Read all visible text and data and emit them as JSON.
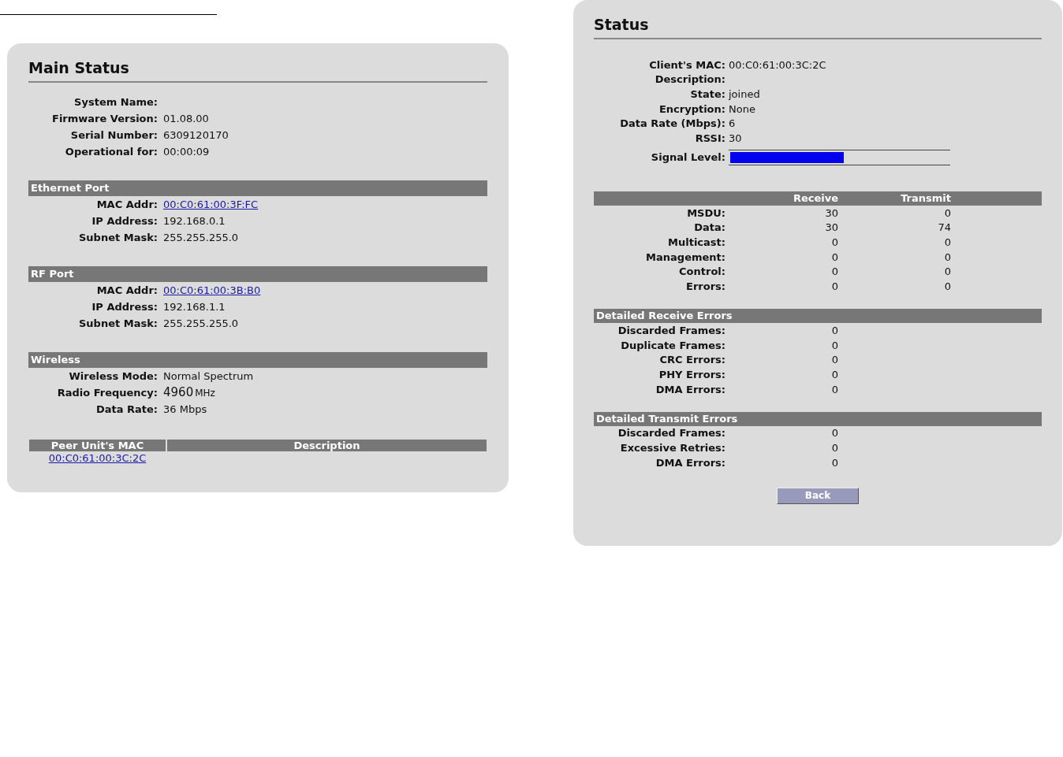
{
  "main_status": {
    "title": "Main Status",
    "info": [
      {
        "label": "System Name:"
      },
      {
        "label": "Firmware Version:",
        "value": "01.08.00"
      },
      {
        "label": "Serial Number:",
        "value": "6309120170"
      },
      {
        "label": "Operational for:",
        "value": "00:00:09"
      }
    ],
    "sections": [
      {
        "title": "Ethernet Port",
        "rows": [
          {
            "kind": "link",
            "label": "MAC Addr:",
            "value": "00:C0:61:00:3F:FC"
          },
          {
            "kind": "text",
            "label": "IP Address:",
            "value": "192.168.0.1"
          },
          {
            "kind": "text",
            "label": "Subnet Mask:",
            "value": "255.255.255.0"
          }
        ]
      },
      {
        "title": "RF Port",
        "rows": [
          {
            "kind": "link",
            "label": "MAC Addr:",
            "value": "00:C0:61:00:3B:B0"
          },
          {
            "kind": "text",
            "label": "IP Address:",
            "value": "192.168.1.1"
          },
          {
            "kind": "text",
            "label": "Subnet Mask:",
            "value": "255.255.255.0"
          }
        ]
      },
      {
        "title": "Wireless",
        "rows": [
          {
            "kind": "text",
            "label": "Wireless Mode:",
            "value": "Normal Spectrum"
          },
          {
            "kind": "frequency",
            "label": "Radio Frequency:",
            "value": "4960",
            "unit": "MHz"
          },
          {
            "kind": "text",
            "label": "Data Rate:",
            "value": "36 Mbps"
          }
        ]
      }
    ],
    "peers": {
      "columns": [
        "Peer Unit's MAC",
        "Description"
      ],
      "rows": [
        {
          "mac": "00:C0:61:00:3C:2C"
        }
      ]
    }
  },
  "status": {
    "title": "Status",
    "info": [
      {
        "label": "Client's MAC:",
        "value": "00:C0:61:00:3C:2C"
      },
      {
        "label": "Description:"
      },
      {
        "label": "State:",
        "value": "joined"
      },
      {
        "label": "Encryption:",
        "value": "None"
      },
      {
        "label": "Data Rate (Mbps):",
        "value": "6"
      },
      {
        "label": "RSSI:",
        "value": "30"
      }
    ],
    "signal": {
      "label": "Signal Level:",
      "level": 0.52
    },
    "counters": {
      "columns": [
        "Receive",
        "Transmit"
      ],
      "rows": [
        {
          "label": "MSDU:",
          "receive": "30",
          "transmit": "0"
        },
        {
          "label": "Data:",
          "receive": "30",
          "transmit": "74"
        },
        {
          "label": "Multicast:",
          "receive": "0",
          "transmit": "0"
        },
        {
          "label": "Management:",
          "receive": "0",
          "transmit": "0"
        },
        {
          "label": "Control:",
          "receive": "0",
          "transmit": "0"
        },
        {
          "label": "Errors:",
          "receive": "0",
          "transmit": "0"
        }
      ]
    },
    "error_sections": [
      {
        "title": "Detailed Receive Errors",
        "rows": [
          {
            "label": "Discarded Frames:",
            "value": "0"
          },
          {
            "label": "Duplicate Frames:",
            "value": "0"
          },
          {
            "label": "CRC Errors:",
            "value": "0"
          },
          {
            "label": "PHY Errors:",
            "value": "0"
          },
          {
            "label": "DMA Errors:",
            "value": "0"
          }
        ]
      },
      {
        "title": "Detailed Transmit Errors",
        "rows": [
          {
            "label": "Discarded Frames:",
            "value": "0"
          },
          {
            "label": "Excessive Retries:",
            "value": "0"
          },
          {
            "label": "DMA Errors:",
            "value": "0"
          }
        ]
      }
    ],
    "back_button": "Back"
  }
}
